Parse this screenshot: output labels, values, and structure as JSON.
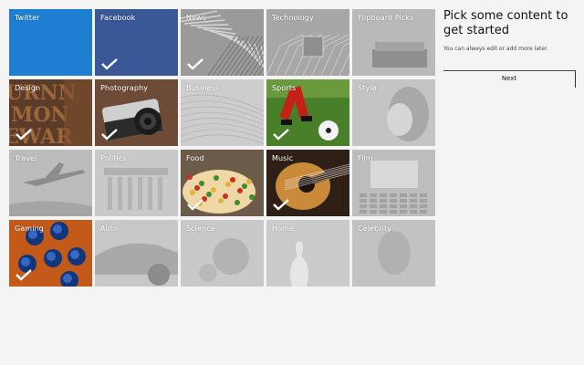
{
  "tiles": [
    {
      "label": "Twitter",
      "selected": false,
      "style": "twitter"
    },
    {
      "label": "Facebook",
      "selected": true,
      "style": "facebook"
    },
    {
      "label": "News",
      "selected": true,
      "style": "news"
    },
    {
      "label": "Technology",
      "selected": false,
      "style": "tech"
    },
    {
      "label": "Flipboard Picks",
      "selected": false,
      "style": "picks"
    },
    {
      "label": "Design",
      "selected": true,
      "style": "design"
    },
    {
      "label": "Photography",
      "selected": true,
      "style": "photo"
    },
    {
      "label": "Business",
      "selected": false,
      "style": "business"
    },
    {
      "label": "Sports",
      "selected": true,
      "style": "sports"
    },
    {
      "label": "Style",
      "selected": false,
      "style": "style"
    },
    {
      "label": "Travel",
      "selected": false,
      "style": "travel"
    },
    {
      "label": "Politics",
      "selected": false,
      "style": "politics"
    },
    {
      "label": "Food",
      "selected": true,
      "style": "food"
    },
    {
      "label": "Music",
      "selected": true,
      "style": "music"
    },
    {
      "label": "Film",
      "selected": false,
      "style": "film"
    },
    {
      "label": "Gaming",
      "selected": true,
      "style": "gaming"
    },
    {
      "label": "Auto",
      "selected": false,
      "style": "auto"
    },
    {
      "label": "Science",
      "selected": false,
      "style": "science"
    },
    {
      "label": "Home",
      "selected": false,
      "style": "home"
    },
    {
      "label": "Celebrity",
      "selected": false,
      "style": "celebrity"
    }
  ],
  "panel": {
    "title": "Pick some content to get started",
    "subtitle": "You can always edit or add more later.",
    "next_label": "Next"
  },
  "colors": {
    "twitter": "#1e7fd2",
    "facebook": "#3a5898",
    "background": "#f4f4f4"
  }
}
